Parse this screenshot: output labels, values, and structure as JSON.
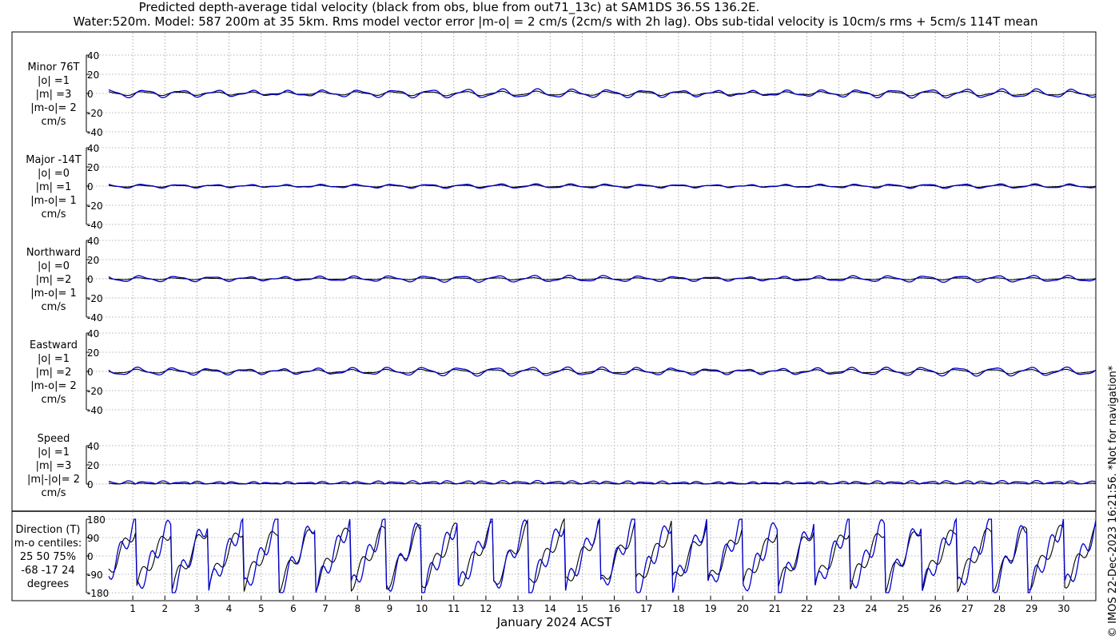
{
  "title_line1": "Predicted depth-average tidal velocity (black from obs, blue from out71_13c) at SAM1DS 36.5S 136.2E.",
  "title_line2": "Water:520m. Model: 587 200m at 35 5km. Rms model vector error |m-o| = 2 cm/s (2cm/s with 2h lag). Obs sub-tidal velocity is 10cm/s rms + 5cm/s 114T mean",
  "credit": "© IMOS 22-Dec-2023 16:21:56. *Not for navigation*",
  "colors": {
    "obs": "#000000",
    "model": "#0000cc",
    "grid": "#9a9a9a"
  },
  "chart_data": {
    "type": "line",
    "xlabel": "January 2024 ACST",
    "x_ticks": [
      "1",
      "2",
      "3",
      "4",
      "5",
      "6",
      "7",
      "8",
      "9",
      "10",
      "11",
      "12",
      "13",
      "14",
      "15",
      "16",
      "17",
      "18",
      "19",
      "20",
      "21",
      "22",
      "23",
      "24",
      "25",
      "26",
      "27",
      "28",
      "29",
      "30"
    ],
    "xlim_days": [
      0.25,
      31.0
    ],
    "series_names": [
      "obs (black)",
      "model (blue)"
    ],
    "panels": [
      {
        "name": "minor",
        "label": [
          "Minor 76T",
          "|o| =1",
          "|m| =3",
          "|m-o|= 2",
          "cm/s"
        ],
        "ylim": [
          -40,
          40
        ],
        "yticks": [
          "40",
          "20",
          "0",
          "-20",
          "-40"
        ],
        "yvals": [
          40,
          20,
          0,
          -20,
          -40
        ],
        "obs_amplitude": 2,
        "model_amplitude": 4
      },
      {
        "name": "major",
        "label": [
          "Major -14T",
          "|o| =0",
          "|m| =1",
          "|m-o|= 1",
          "cm/s"
        ],
        "ylim": [
          -40,
          40
        ],
        "yticks": [
          "40",
          "20",
          "0",
          "-20",
          "-40"
        ],
        "yvals": [
          40,
          20,
          0,
          -20,
          -40
        ],
        "obs_amplitude": 1,
        "model_amplitude": 2
      },
      {
        "name": "northward",
        "label": [
          "Northward",
          "|o| =0",
          "|m| =2",
          "|m-o|= 1",
          "cm/s"
        ],
        "ylim": [
          -40,
          40
        ],
        "yticks": [
          "40",
          "20",
          "0",
          "-20",
          "-40"
        ],
        "yvals": [
          40,
          20,
          0,
          -20,
          -40
        ],
        "obs_amplitude": 1,
        "model_amplitude": 3
      },
      {
        "name": "eastward",
        "label": [
          "Eastward",
          "|o| =1",
          "|m| =2",
          "|m-o|= 2",
          "cm/s"
        ],
        "ylim": [
          -40,
          40
        ],
        "yticks": [
          "40",
          "20",
          "0",
          "-20",
          "-40"
        ],
        "yvals": [
          40,
          20,
          0,
          -20,
          -40
        ],
        "obs_amplitude": 2,
        "model_amplitude": 4
      },
      {
        "name": "speed",
        "label": [
          "Speed",
          "|o| =1",
          "|m| =3",
          "|m|-|o|= 2",
          "cm/s"
        ],
        "ylim": [
          0,
          40
        ],
        "yticks": [
          "40",
          "20",
          "0"
        ],
        "yvals": [
          40,
          20,
          0
        ],
        "obs_amplitude": 1,
        "model_amplitude": 3
      },
      {
        "name": "direction",
        "label": [
          "Direction (T)",
          "m-o centiles:",
          "25  50  75%",
          "-68 -17  24",
          "degrees"
        ],
        "ylim": [
          -180,
          180
        ],
        "yticks": [
          "180",
          "90",
          "0",
          "-90",
          "-180"
        ],
        "yvals": [
          180,
          90,
          0,
          -90,
          -180
        ]
      }
    ],
    "direction_centiles": {
      "p25": -68,
      "p50": -17,
      "p75": 24
    }
  }
}
